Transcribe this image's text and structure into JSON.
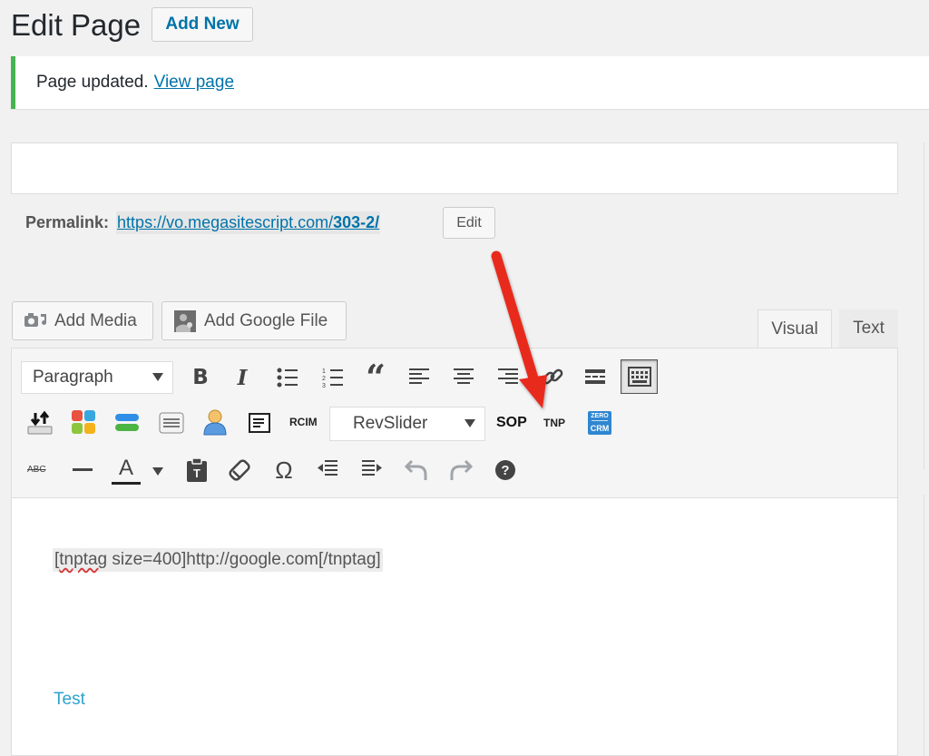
{
  "header": {
    "title": "Edit Page",
    "add_new_label": "Add New"
  },
  "notice": {
    "message": "Page updated.",
    "link_text": "View page"
  },
  "permalink": {
    "label": "Permalink:",
    "url_prefix": "https://vo.megasitescript.com/",
    "url_slug": "303-2/",
    "edit_label": "Edit"
  },
  "media": {
    "add_media_label": "Add Media",
    "add_google_file_label": "Add Google File"
  },
  "tabs": {
    "visual_label": "Visual",
    "text_label": "Text"
  },
  "toolbar": {
    "format_select": "Paragraph",
    "revslider_select": "RevSlider",
    "rcim_label": "RCIM",
    "sop_label": "SOP",
    "tnp_label": "TNP",
    "abc_label": "ABC",
    "text_color_label": "A",
    "zero_label": "ZERO",
    "crm_label": "CRM"
  },
  "editor": {
    "shortcode_misspelled": "tnptag",
    "shortcode_rest": " size=400]http://google.com[/tnptag]",
    "bracket_open": "[",
    "test_link": "Test"
  },
  "annotation": {
    "arrow_color": "#e8291c"
  },
  "colors": {
    "link": "#0073aa",
    "notice_border": "#46b450",
    "test_text": "#2ea2cc"
  }
}
